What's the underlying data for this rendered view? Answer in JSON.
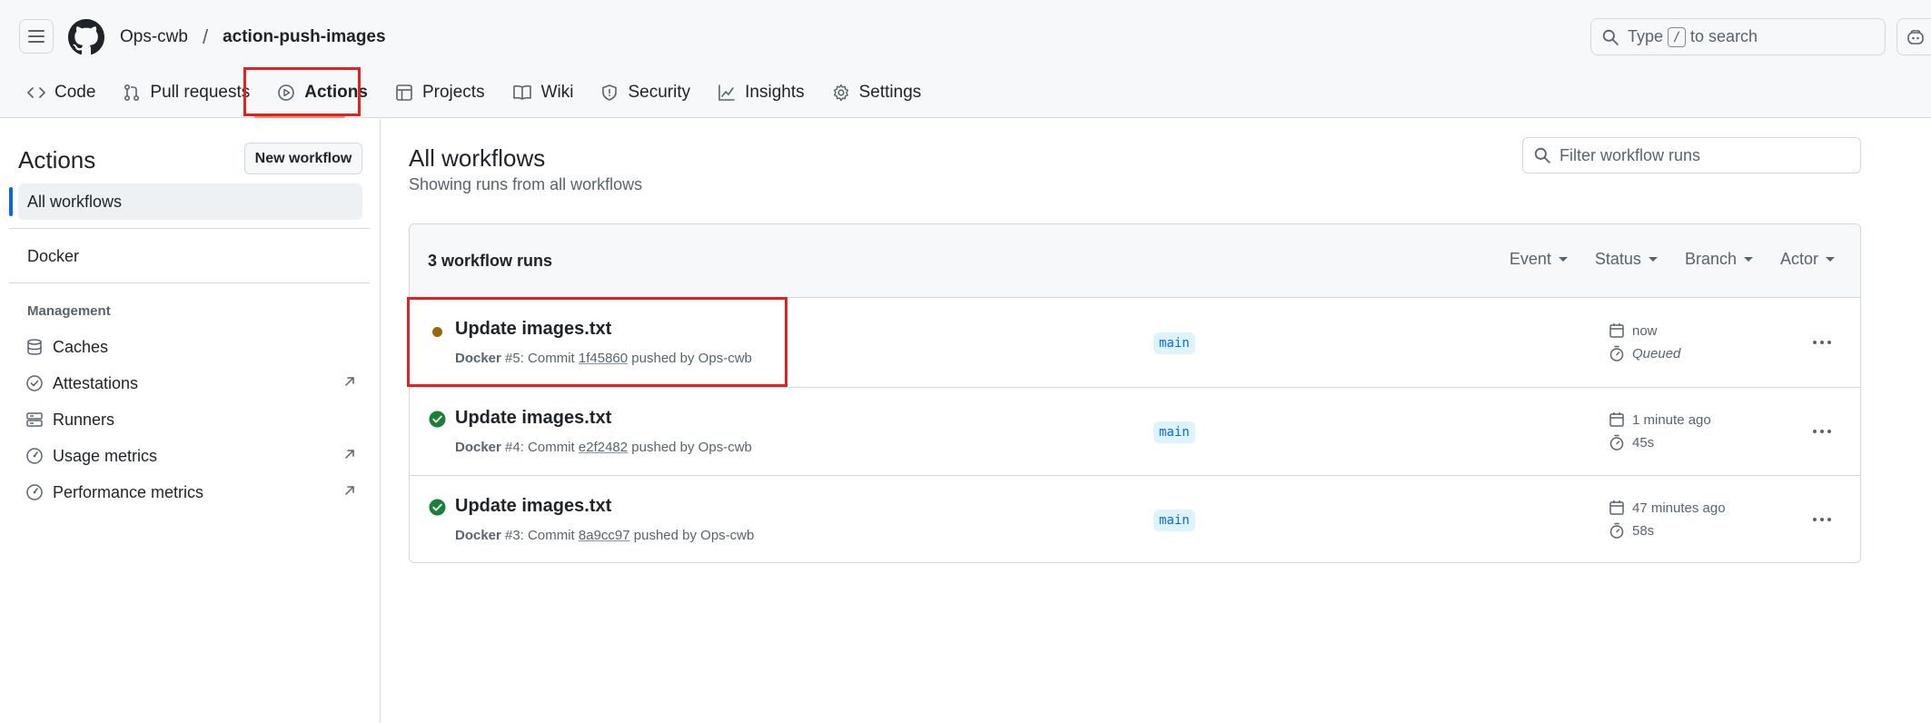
{
  "header": {
    "owner": "Ops-cwb",
    "separator": "/",
    "repo": "action-push-images",
    "search_prefix": "Type",
    "search_key": "/",
    "search_suffix": "to search"
  },
  "tabs": [
    {
      "label": "Code",
      "icon": "code-icon"
    },
    {
      "label": "Pull requests",
      "icon": "pull-request-icon"
    },
    {
      "label": "Actions",
      "icon": "play-icon",
      "active": true
    },
    {
      "label": "Projects",
      "icon": "table-icon"
    },
    {
      "label": "Wiki",
      "icon": "book-icon"
    },
    {
      "label": "Security",
      "icon": "shield-icon"
    },
    {
      "label": "Insights",
      "icon": "graph-icon"
    },
    {
      "label": "Settings",
      "icon": "gear-icon"
    }
  ],
  "sidebar": {
    "title": "Actions",
    "new_workflow": "New workflow",
    "all_workflows": "All workflows",
    "workflows": [
      "Docker"
    ],
    "management_heading": "Management",
    "management": [
      {
        "label": "Caches",
        "icon": "database-icon",
        "external": false
      },
      {
        "label": "Attestations",
        "icon": "verified-icon",
        "external": true
      },
      {
        "label": "Runners",
        "icon": "server-icon",
        "external": false
      },
      {
        "label": "Usage metrics",
        "icon": "meter-icon",
        "external": true
      },
      {
        "label": "Performance metrics",
        "icon": "meter-icon",
        "external": true
      }
    ]
  },
  "main": {
    "title": "All workflows",
    "subtitle": "Showing runs from all workflows",
    "filter_placeholder": "Filter workflow runs",
    "runs_count": "3 workflow runs",
    "filters": [
      "Event",
      "Status",
      "Branch",
      "Actor"
    ],
    "runs": [
      {
        "title": "Update images.txt",
        "workflow": "Docker",
        "number": "#5",
        "commit_word": ": Commit",
        "sha": "1f45860",
        "pushed_by": "pushed by Ops-cwb",
        "branch": "main",
        "when": "now",
        "duration": "Queued",
        "status": "queued"
      },
      {
        "title": "Update images.txt",
        "workflow": "Docker",
        "number": "#4",
        "commit_word": ": Commit",
        "sha": "e2f2482",
        "pushed_by": "pushed by Ops-cwb",
        "branch": "main",
        "when": "1 minute ago",
        "duration": "45s",
        "status": "success"
      },
      {
        "title": "Update images.txt",
        "workflow": "Docker",
        "number": "#3",
        "commit_word": ": Commit",
        "sha": "8a9cc97",
        "pushed_by": "pushed by Ops-cwb",
        "branch": "main",
        "when": "47 minutes ago",
        "duration": "58s",
        "status": "success"
      }
    ]
  },
  "colors": {
    "accent": "#0969da",
    "success": "#1a7f37",
    "queued": "#9a6700",
    "highlight": "#e5201f",
    "tab_underline": "#fd8c73"
  }
}
